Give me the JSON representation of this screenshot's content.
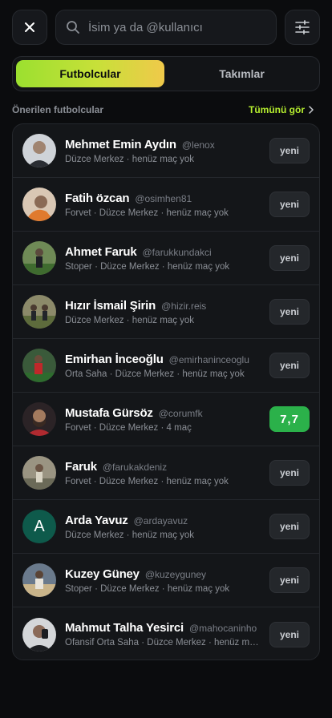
{
  "search": {
    "placeholder": "İsim ya da @kullanıcı"
  },
  "tabs": [
    {
      "label": "Futbolcular",
      "active": true
    },
    {
      "label": "Takımlar",
      "active": false
    }
  ],
  "section": {
    "title": "Önerilen futbolcular",
    "see_all": "Tümünü gör"
  },
  "colors": {
    "accent": "#b6ef2f",
    "rating_badge": "#2bb14a"
  },
  "players": [
    {
      "name": "Mehmet Emin Aydın",
      "handle": "@lenox",
      "meta": "Düzce Merkez · henüz maç yok",
      "badge": "yeni"
    },
    {
      "name": "Fatih özcan",
      "handle": "@osimhen81",
      "meta": "Forvet · Düzce Merkez · henüz maç yok",
      "badge": "yeni"
    },
    {
      "name": "Ahmet Faruk",
      "handle": "@farukkundakci",
      "meta": "Stoper · Düzce Merkez · henüz maç yok",
      "badge": "yeni"
    },
    {
      "name": "Hızır İsmail Şirin",
      "handle": "@hizir.reis",
      "meta": "Düzce Merkez · henüz maç yok",
      "badge": "yeni"
    },
    {
      "name": "Emirhan İnceoğlu",
      "handle": "@emirhaninceoglu",
      "meta": "Orta Saha · Düzce Merkez · henüz maç yok",
      "badge": "yeni"
    },
    {
      "name": "Mustafa Gürsöz",
      "handle": "@corumfk",
      "meta": "Forvet · Düzce Merkez · 4 maç",
      "badge": "7,7"
    },
    {
      "name": "Faruk",
      "handle": "@farukakdeniz",
      "meta": "Forvet · Düzce Merkez · henüz maç yok",
      "badge": "yeni"
    },
    {
      "name": "Arda Yavuz",
      "handle": "@ardayavuz",
      "meta": "Düzce Merkez · henüz maç yok",
      "badge": "yeni",
      "initial": "A"
    },
    {
      "name": "Kuzey Güney",
      "handle": "@kuzeyguney",
      "meta": "Stoper · Düzce Merkez · henüz maç yok",
      "badge": "yeni"
    },
    {
      "name": "Mahmut Talha Yesirci",
      "handle": "@mahocaninho",
      "meta": "Ofansif Orta Saha · Düzce Merkez · henüz ma...",
      "badge": "yeni"
    }
  ]
}
